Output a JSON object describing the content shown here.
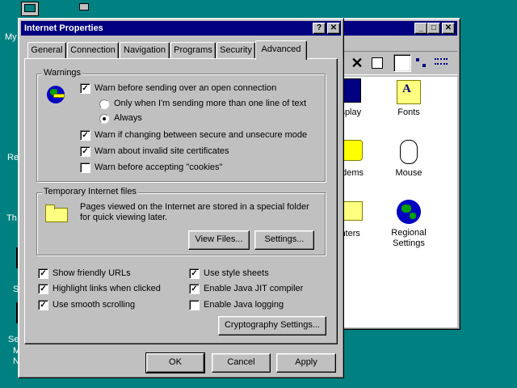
{
  "desktop": {
    "labels": [
      "My",
      "Re",
      "Th",
      "S",
      "Se",
      "M",
      "N"
    ]
  },
  "control_panel": {
    "items": [
      {
        "label": "isplay",
        "icon": "display-icon"
      },
      {
        "label": "Fonts",
        "icon": "fonts-folder-icon"
      },
      {
        "label": "odems",
        "icon": "modems-icon"
      },
      {
        "label": "Mouse",
        "icon": "mouse-icon"
      },
      {
        "label": "inters",
        "icon": "printers-icon"
      },
      {
        "label": "Regional\nSettings",
        "icon": "globe-icon"
      }
    ]
  },
  "dialog": {
    "title": "Internet Properties",
    "help_glyph": "?",
    "close_glyph": "✕",
    "tabs": [
      "General",
      "Connection",
      "Navigation",
      "Programs",
      "Security",
      "Advanced"
    ],
    "active_tab": "Advanced",
    "warnings": {
      "label": "Warnings",
      "open_connection": "Warn before sending over an open connection",
      "only_multi_line": "Only when I'm sending  more than one line of text",
      "always": "Always",
      "secure_change": "Warn if changing between secure and unsecure mode",
      "invalid_certs": "Warn about invalid site certificates",
      "cookies": "Warn before accepting \"cookies\""
    },
    "temp_files": {
      "label": "Temporary Internet files",
      "description": "Pages viewed on the Internet are stored in a special folder for quick viewing later.",
      "view_files": "View Files...",
      "settings": "Settings..."
    },
    "options": {
      "friendly_urls": "Show friendly URLs",
      "highlight_links": "Highlight links when clicked",
      "smooth_scroll": "Use smooth scrolling",
      "style_sheets": "Use style sheets",
      "java_jit": "Enable Java JIT compiler",
      "java_logging": "Enable Java logging"
    },
    "crypto_button": "Cryptography Settings...",
    "ok": "OK",
    "cancel": "Cancel",
    "apply": "Apply",
    "check_glyph": "✓"
  }
}
